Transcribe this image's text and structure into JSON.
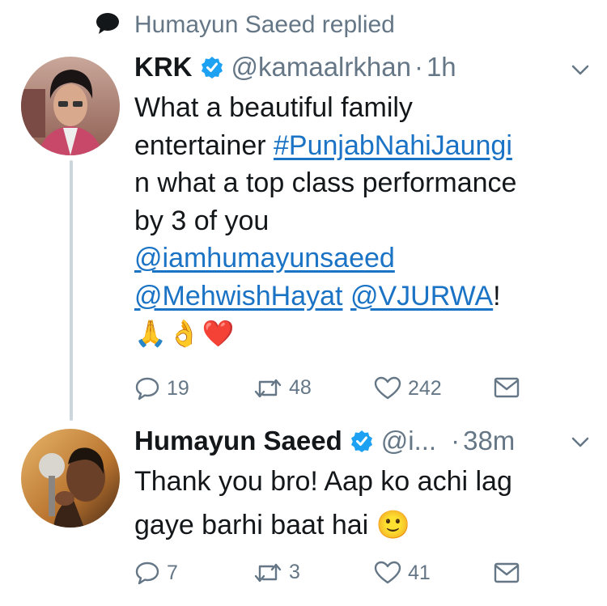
{
  "context": {
    "icon": "speech-bubble-icon",
    "text": "Humayun Saeed replied"
  },
  "tweets": [
    {
      "avatar": "krk-avatar",
      "name": "KRK",
      "handle": "@kamaalrkhan",
      "separator": "·",
      "time": "1h",
      "body": {
        "line1": "What a beautiful family",
        "line2_text": "entertainer ",
        "hashtag": "#PunjabNahiJaungi",
        "line3": "n what a top class performance",
        "line4": "by 3 of you",
        "mention1": "@iamhumayunsaeed",
        "mention2": "@MehwishHayat",
        "space": " ",
        "mention3": "@VJURWA",
        "exclaim": "!",
        "emojis": [
          "🙏",
          "👌",
          "❤️"
        ]
      },
      "actions": {
        "replies": "19",
        "retweets": "48",
        "likes": "242"
      }
    },
    {
      "avatar": "humayun-saeed-avatar",
      "name": "Humayun Saeed",
      "handle": "@i...",
      "separator": "·",
      "time": "38m",
      "body": {
        "line1": "Thank you bro! Aap ko achi lag",
        "line2": "gaye barhi baat hai",
        "emoji": "🙂"
      },
      "actions": {
        "replies": "7",
        "retweets": "3",
        "likes": "41"
      }
    }
  ],
  "colors": {
    "link": "#1b73c5",
    "secondary": "#657786",
    "verified": "#1da1f2",
    "thread": "#ccd6dd"
  }
}
